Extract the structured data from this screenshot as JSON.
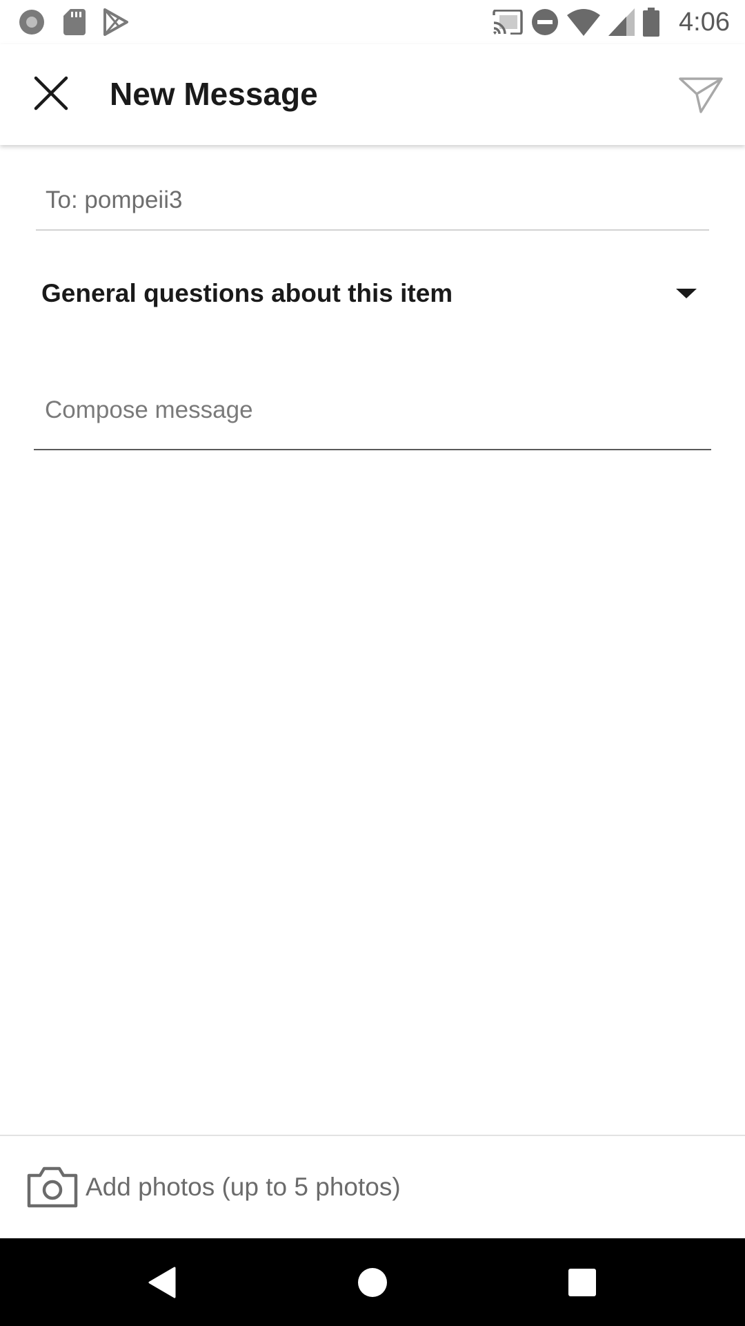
{
  "status_bar": {
    "time": "4:06",
    "left_icons": [
      "record-icon",
      "sd-card-icon",
      "play-store-icon"
    ],
    "right_icons": [
      "cast-icon",
      "do-not-disturb-icon",
      "wifi-icon",
      "signal-icon",
      "battery-icon"
    ]
  },
  "app_bar": {
    "title": "New Message",
    "close_icon": "close-icon",
    "send_icon": "send-icon"
  },
  "form": {
    "to_value": "To: pompeii3",
    "subject_selected": "General questions about this item",
    "compose_placeholder": "Compose message",
    "compose_value": ""
  },
  "attachments": {
    "label": "Add photos (up to 5 photos)",
    "icon": "camera-icon"
  },
  "nav_bar": {
    "buttons": [
      "back-icon",
      "home-icon",
      "recents-icon"
    ]
  },
  "colors": {
    "title": "#1a1a1a",
    "secondary_text": "#6e6e6e",
    "nav_background": "#000000"
  }
}
